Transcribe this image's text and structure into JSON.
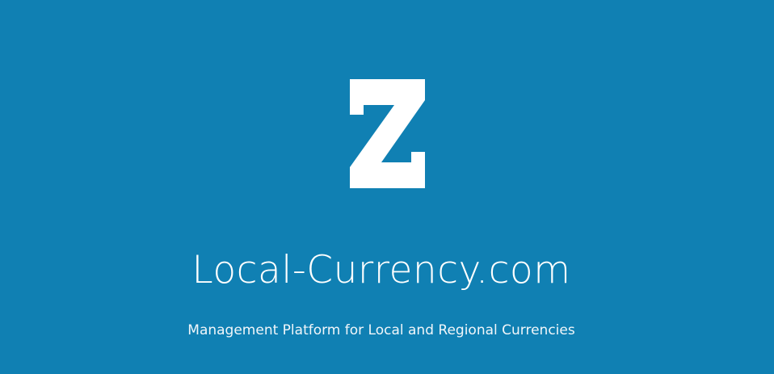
{
  "brand": {
    "logo_icon": "z-logo-icon",
    "title": "Local-Currency.com",
    "tagline": "Management Platform for Local and Regional Currencies"
  },
  "colors": {
    "background": "#1080b3",
    "foreground": "#ffffff"
  }
}
